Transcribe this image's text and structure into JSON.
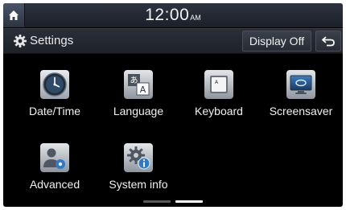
{
  "statusbar": {
    "home_icon": "home-icon",
    "time": "12:00",
    "ampm": "AM"
  },
  "titlebar": {
    "title": "Settings",
    "title_icon": "gear-icon",
    "display_off": "Display Off",
    "back_icon": "back-arrow-icon"
  },
  "menu": {
    "items": [
      {
        "label": "Date/Time",
        "icon": "clock-icon"
      },
      {
        "label": "Language",
        "icon": "language-icon"
      },
      {
        "label": "Keyboard",
        "icon": "keyboard-icon"
      },
      {
        "label": "Screensaver",
        "icon": "screensaver-icon"
      },
      {
        "label": "Advanced",
        "icon": "advanced-settings-icon"
      },
      {
        "label": "System info",
        "icon": "system-info-icon"
      }
    ]
  },
  "pager": {
    "page_count": 2,
    "current_page": 2
  }
}
